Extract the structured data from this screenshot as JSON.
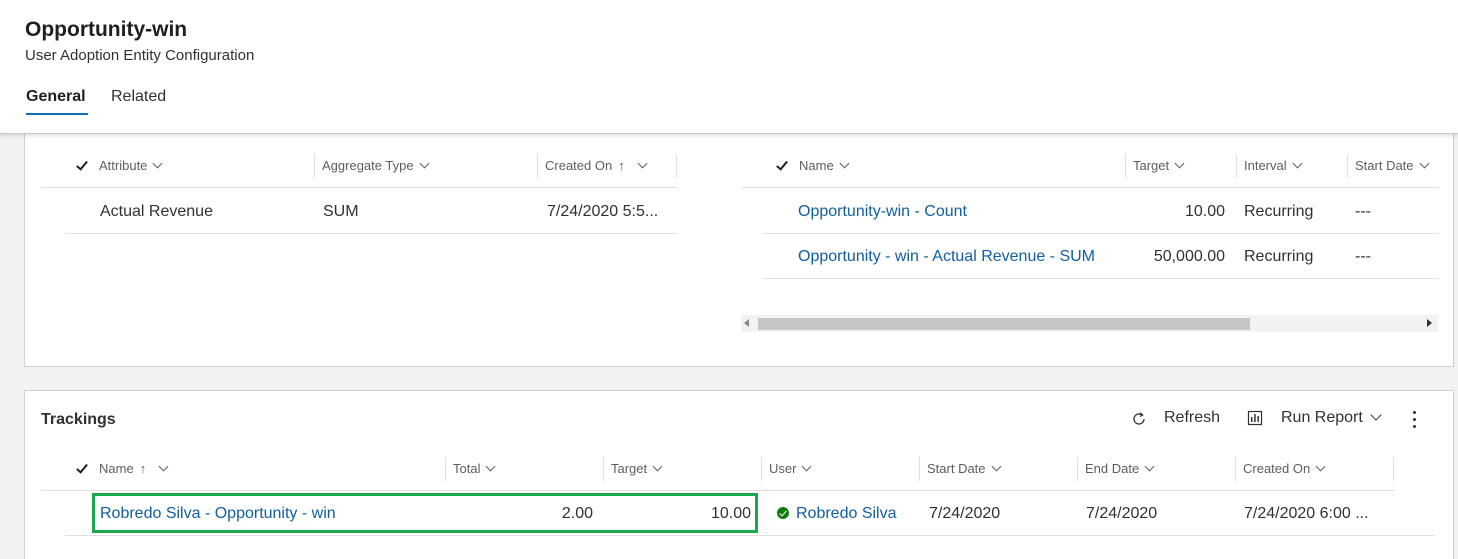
{
  "header": {
    "title": "Opportunity-win",
    "subtitle": "User Adoption Entity Configuration",
    "tabs": [
      {
        "label": "General",
        "active": true
      },
      {
        "label": "Related",
        "active": false
      }
    ]
  },
  "attributes_grid": {
    "columns": [
      "Attribute",
      "Aggregate Type",
      "Created On"
    ],
    "rows": [
      {
        "attribute": "Actual Revenue",
        "aggregate_type": "SUM",
        "created_on": "7/24/2020 5:5..."
      }
    ]
  },
  "goals_grid": {
    "columns": [
      "Name",
      "Target",
      "Interval",
      "Start Date"
    ],
    "rows": [
      {
        "name": "Opportunity-win - Count",
        "target": "10.00",
        "interval": "Recurring",
        "start_date": "---"
      },
      {
        "name": "Opportunity - win - Actual Revenue - SUM",
        "target": "50,000.00",
        "interval": "Recurring",
        "start_date": "---"
      }
    ]
  },
  "trackings": {
    "title": "Trackings",
    "commands": {
      "refresh": "Refresh",
      "run_report": "Run Report"
    },
    "columns": [
      "Name",
      "Total",
      "Target",
      "User",
      "Start Date",
      "End Date",
      "Created On"
    ],
    "rows": [
      {
        "name": "Robredo Silva - Opportunity - win",
        "total": "2.00",
        "target": "10.00",
        "user": "Robredo Silva",
        "start_date": "7/24/2020",
        "end_date": "7/24/2020",
        "created_on": "7/24/2020 6:00 ..."
      }
    ]
  },
  "colors": {
    "link": "#115ea3",
    "tab_underline": "#0f6cbd",
    "highlight": "#1aa84a",
    "status_active": "#107c10"
  },
  "icons": [
    "check-icon",
    "chevron-down-icon",
    "sort-ascending-icon",
    "refresh-icon",
    "report-icon",
    "more-icon",
    "status-active-icon"
  ]
}
